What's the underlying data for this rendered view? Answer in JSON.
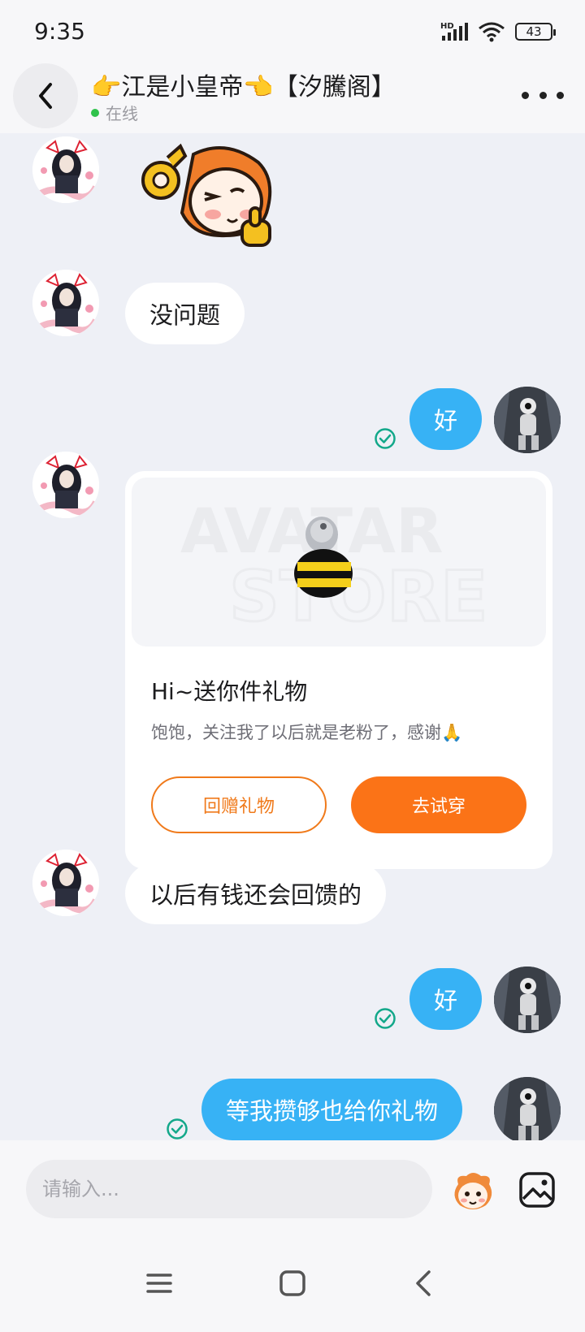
{
  "status_bar": {
    "time": "9:35",
    "network_label": "HD",
    "battery": "43"
  },
  "header": {
    "title": "👉江是小皇帝👈【汐騰阁】",
    "status": "在线"
  },
  "messages": [
    {
      "from": "other",
      "type": "sticker",
      "icon": "cartoon-okay-sticker"
    },
    {
      "from": "other",
      "type": "text",
      "text": "没问题"
    },
    {
      "from": "me",
      "type": "text",
      "text": "好",
      "read": true
    },
    {
      "from": "other",
      "type": "gift",
      "icon": "bee-helmet-gift"
    },
    {
      "from": "other",
      "type": "text",
      "text": "以后有钱还会回馈的"
    },
    {
      "from": "me",
      "type": "text",
      "text": "好",
      "read": true
    },
    {
      "from": "me",
      "type": "text",
      "text": "等我攒够也给你礼物",
      "read": true
    }
  ],
  "gift_card": {
    "watermark_line1": "AVATAR",
    "watermark_line2": "STORE",
    "title": "Hi~送你件礼物",
    "description": "饱饱，关注我了以后就是老粉了，感谢🙏",
    "return_button": "回赠礼物",
    "try_button": "去试穿"
  },
  "input": {
    "placeholder": "请输入..."
  },
  "colors": {
    "accent_blue": "#37b2f5",
    "accent_orange": "#fb7317",
    "read_check": "#13a88a",
    "online": "#2fc24b"
  }
}
